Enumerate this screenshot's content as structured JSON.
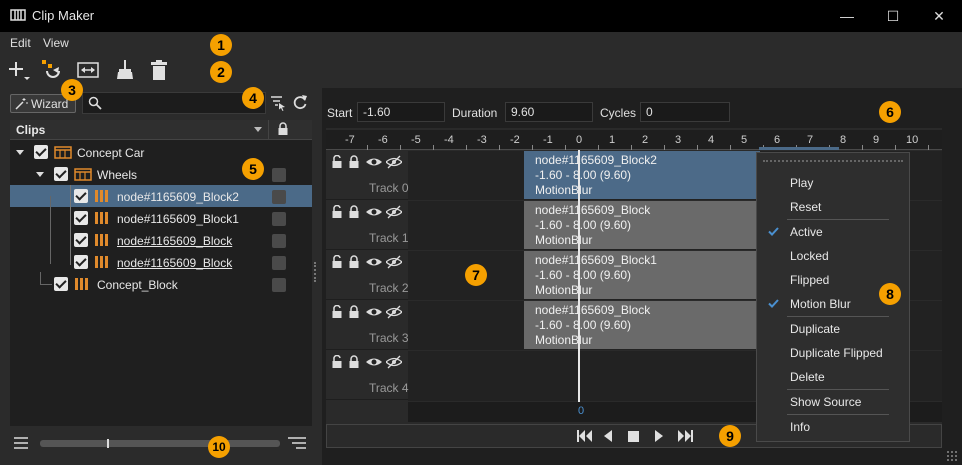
{
  "window": {
    "title": "Clip Maker",
    "minimize": "—",
    "maximize": "☐",
    "close": "✕"
  },
  "menu": {
    "edit": "Edit",
    "view": "View"
  },
  "toolbar": {
    "add_icon": "plus-dropdown-icon",
    "merge_icon": "merge-icon",
    "fit_icon": "fit-width-icon",
    "clean_icon": "broom-icon",
    "delete_icon": "trash-icon"
  },
  "left": {
    "wizard_label": "Wizard",
    "search_placeholder": "",
    "tree_header": "Clips",
    "tree": [
      {
        "label": "Concept Car",
        "level": 0,
        "expand": true,
        "checked": true,
        "kind": "group",
        "underline": false,
        "lockbox": false
      },
      {
        "label": "Wheels",
        "level": 1,
        "expand": true,
        "checked": true,
        "kind": "group",
        "underline": false,
        "lockbox": true
      },
      {
        "label": "node#1165609_Block2",
        "level": 2,
        "checked": true,
        "kind": "clip",
        "underline": false,
        "lockbox": true,
        "selected": true
      },
      {
        "label": "node#1165609_Block1",
        "level": 2,
        "checked": true,
        "kind": "clip",
        "underline": false,
        "lockbox": true
      },
      {
        "label": "node#1165609_Block",
        "level": 2,
        "checked": true,
        "kind": "clip",
        "underline": true,
        "lockbox": true
      },
      {
        "label": "node#1165609_Block",
        "level": 2,
        "checked": true,
        "kind": "clip",
        "underline": true,
        "lockbox": true
      },
      {
        "label": "Concept_Block",
        "level": 1,
        "checked": true,
        "kind": "clip",
        "underline": false,
        "lockbox": true
      }
    ]
  },
  "fields": {
    "start_label": "Start",
    "start_value": "-1.60",
    "duration_label": "Duration",
    "duration_value": "9.60",
    "cycles_label": "Cycles",
    "cycles_value": "0"
  },
  "ruler": {
    "ticks": [
      "-7",
      "-6",
      "-5",
      "-4",
      "-3",
      "-2",
      "-1",
      "0",
      "1",
      "2",
      "3",
      "4",
      "5",
      "6",
      "7",
      "8",
      "9",
      "10"
    ],
    "cursor_label": "0"
  },
  "tracks": [
    {
      "label": "Track 0",
      "clip": {
        "name": "node#1165609_Block2",
        "range": "-1.60 - 8.00 (9.60)",
        "effect": "MotionBlur",
        "selected": true
      }
    },
    {
      "label": "Track 1",
      "clip": {
        "name": "node#1165609_Block",
        "range": "-1.60 - 8.00 (9.60)",
        "effect": "MotionBlur",
        "selected": false
      }
    },
    {
      "label": "Track 2",
      "clip": {
        "name": "node#1165609_Block1",
        "range": "-1.60 - 8.00 (9.60)",
        "effect": "MotionBlur",
        "selected": false
      }
    },
    {
      "label": "Track 3",
      "clip": {
        "name": "node#1165609_Block",
        "range": "-1.60 - 8.00 (9.60)",
        "effect": "MotionBlur",
        "selected": false
      }
    },
    {
      "label": "Track 4",
      "clip": null
    }
  ],
  "context_menu": [
    {
      "label": "Play",
      "checked": false
    },
    {
      "label": "Reset",
      "checked": false,
      "sep_after": true
    },
    {
      "label": "Active",
      "checked": true
    },
    {
      "label": "Locked",
      "checked": false
    },
    {
      "label": "Flipped",
      "checked": false
    },
    {
      "label": "Motion Blur",
      "checked": true,
      "sep_after": true
    },
    {
      "label": "Duplicate",
      "checked": false
    },
    {
      "label": "Duplicate Flipped",
      "checked": false
    },
    {
      "label": "Delete",
      "checked": false,
      "sep_after": true
    },
    {
      "label": "Show Source",
      "checked": false,
      "sep_after": true
    },
    {
      "label": "Info",
      "checked": false
    }
  ],
  "callouts": [
    "1",
    "2",
    "3",
    "4",
    "5",
    "6",
    "7",
    "8",
    "9",
    "10"
  ],
  "colors": {
    "accent": "#f5a000",
    "selection": "#4b6a88",
    "clip": "#6a6a6a",
    "folder": "#e08a2c"
  }
}
